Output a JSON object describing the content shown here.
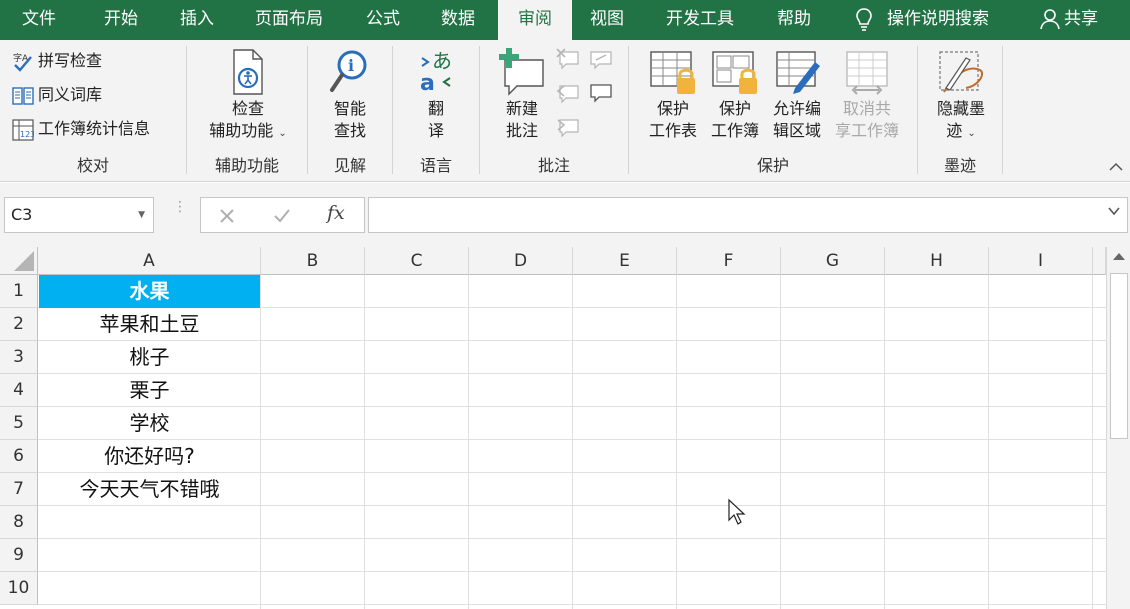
{
  "tabs": [
    {
      "label": "文件"
    },
    {
      "label": "开始"
    },
    {
      "label": "插入"
    },
    {
      "label": "页面布局"
    },
    {
      "label": "公式"
    },
    {
      "label": "数据"
    },
    {
      "label": "审阅"
    },
    {
      "label": "视图"
    },
    {
      "label": "开发工具"
    },
    {
      "label": "帮助"
    }
  ],
  "active_tab": "审阅",
  "tell_me": "操作说明搜索",
  "share": "共享",
  "ribbon": {
    "proofing": {
      "spell": "拼写检查",
      "thesaurus": "同义词库",
      "stats": "工作簿统计信息",
      "label": "校对"
    },
    "accessibility": {
      "check_line1": "检查",
      "check_line2": "辅助功能",
      "label": "辅助功能"
    },
    "insights": {
      "smart_line1": "智能",
      "smart_line2": "查找",
      "label": "见解"
    },
    "language": {
      "translate_line1": "翻",
      "translate_line2": "译",
      "label": "语言"
    },
    "comments": {
      "new_line1": "新建",
      "new_line2": "批注",
      "label": "批注"
    },
    "protect": {
      "sheet_line1": "保护",
      "sheet_line2": "工作表",
      "book_line1": "保护",
      "book_line2": "工作簿",
      "ranges_line1": "允许编",
      "ranges_line2": "辑区域",
      "unshare_line1": "取消共",
      "unshare_line2": "享工作簿",
      "label": "保护"
    },
    "ink": {
      "hide_line1": "隐藏墨",
      "hide_line2": "迹",
      "label": "墨迹"
    }
  },
  "name_box": "C3",
  "formula_symbol": "fx",
  "formula_value": "",
  "columns": [
    "A",
    "B",
    "C",
    "D",
    "E",
    "F",
    "G",
    "H",
    "I"
  ],
  "rows": [
    "1",
    "2",
    "3",
    "4",
    "5",
    "6",
    "7",
    "8",
    "9",
    "10"
  ],
  "cells_A": [
    "水果",
    "苹果和土豆",
    "桃子",
    "栗子",
    "学校",
    "你还好吗?",
    "今天天气不错哦",
    "",
    "",
    ""
  ],
  "colors": {
    "accent": "#217346",
    "header_fill": "#00b0f0"
  }
}
